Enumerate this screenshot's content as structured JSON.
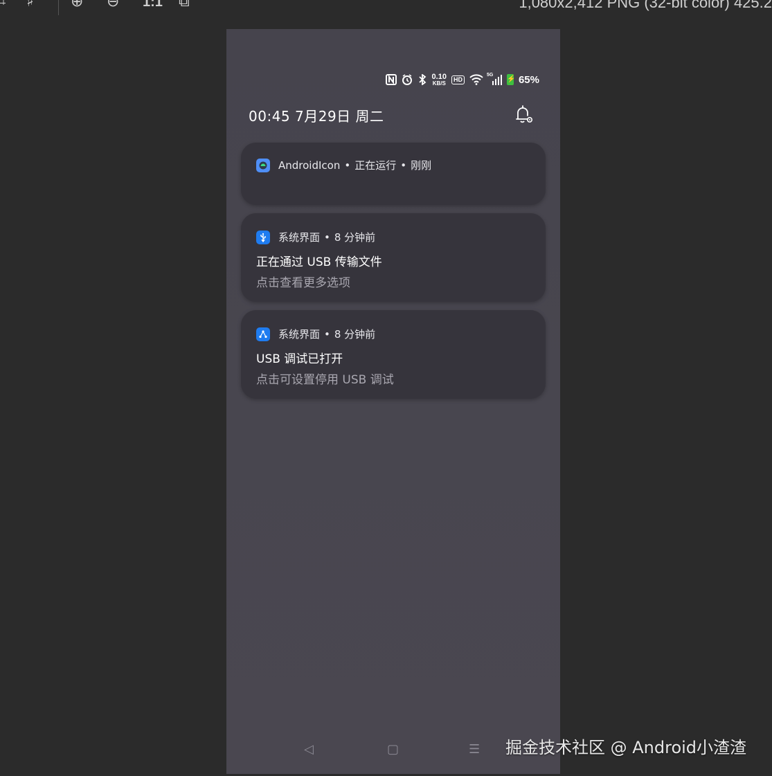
{
  "viewer": {
    "zoom_label": "1:1",
    "file_info": "1,080x2,412 PNG (32-bit color) 425.2"
  },
  "status_bar": {
    "network_speed_value": "0.10",
    "network_speed_unit": "KB/S",
    "hd_label": "HD",
    "signal_label": "5G",
    "battery": "65%",
    "battery_color": "#3fbf3f"
  },
  "header": {
    "datetime": "00:45  7月29日 周二"
  },
  "notifications": [
    {
      "app": "AndroidIcon",
      "meta1": "正在运行",
      "meta2": "刚刚",
      "icon_color": "#4f8ff7"
    },
    {
      "app": "系统界面",
      "meta1": "8 分钟前",
      "title": "正在通过 USB 传输文件",
      "subtitle": "点击查看更多选项",
      "icon_color": "#1f7cf0"
    },
    {
      "app": "系统界面",
      "meta1": "8 分钟前",
      "title": "USB 调试已打开",
      "subtitle": "点击可设置停用 USB 调试",
      "icon_color": "#1f7cf0"
    }
  ],
  "navbar": {
    "back": "◁",
    "home": "▢",
    "recents": "☰"
  },
  "watermark": "掘金技术社区 @ Android小渣渣"
}
